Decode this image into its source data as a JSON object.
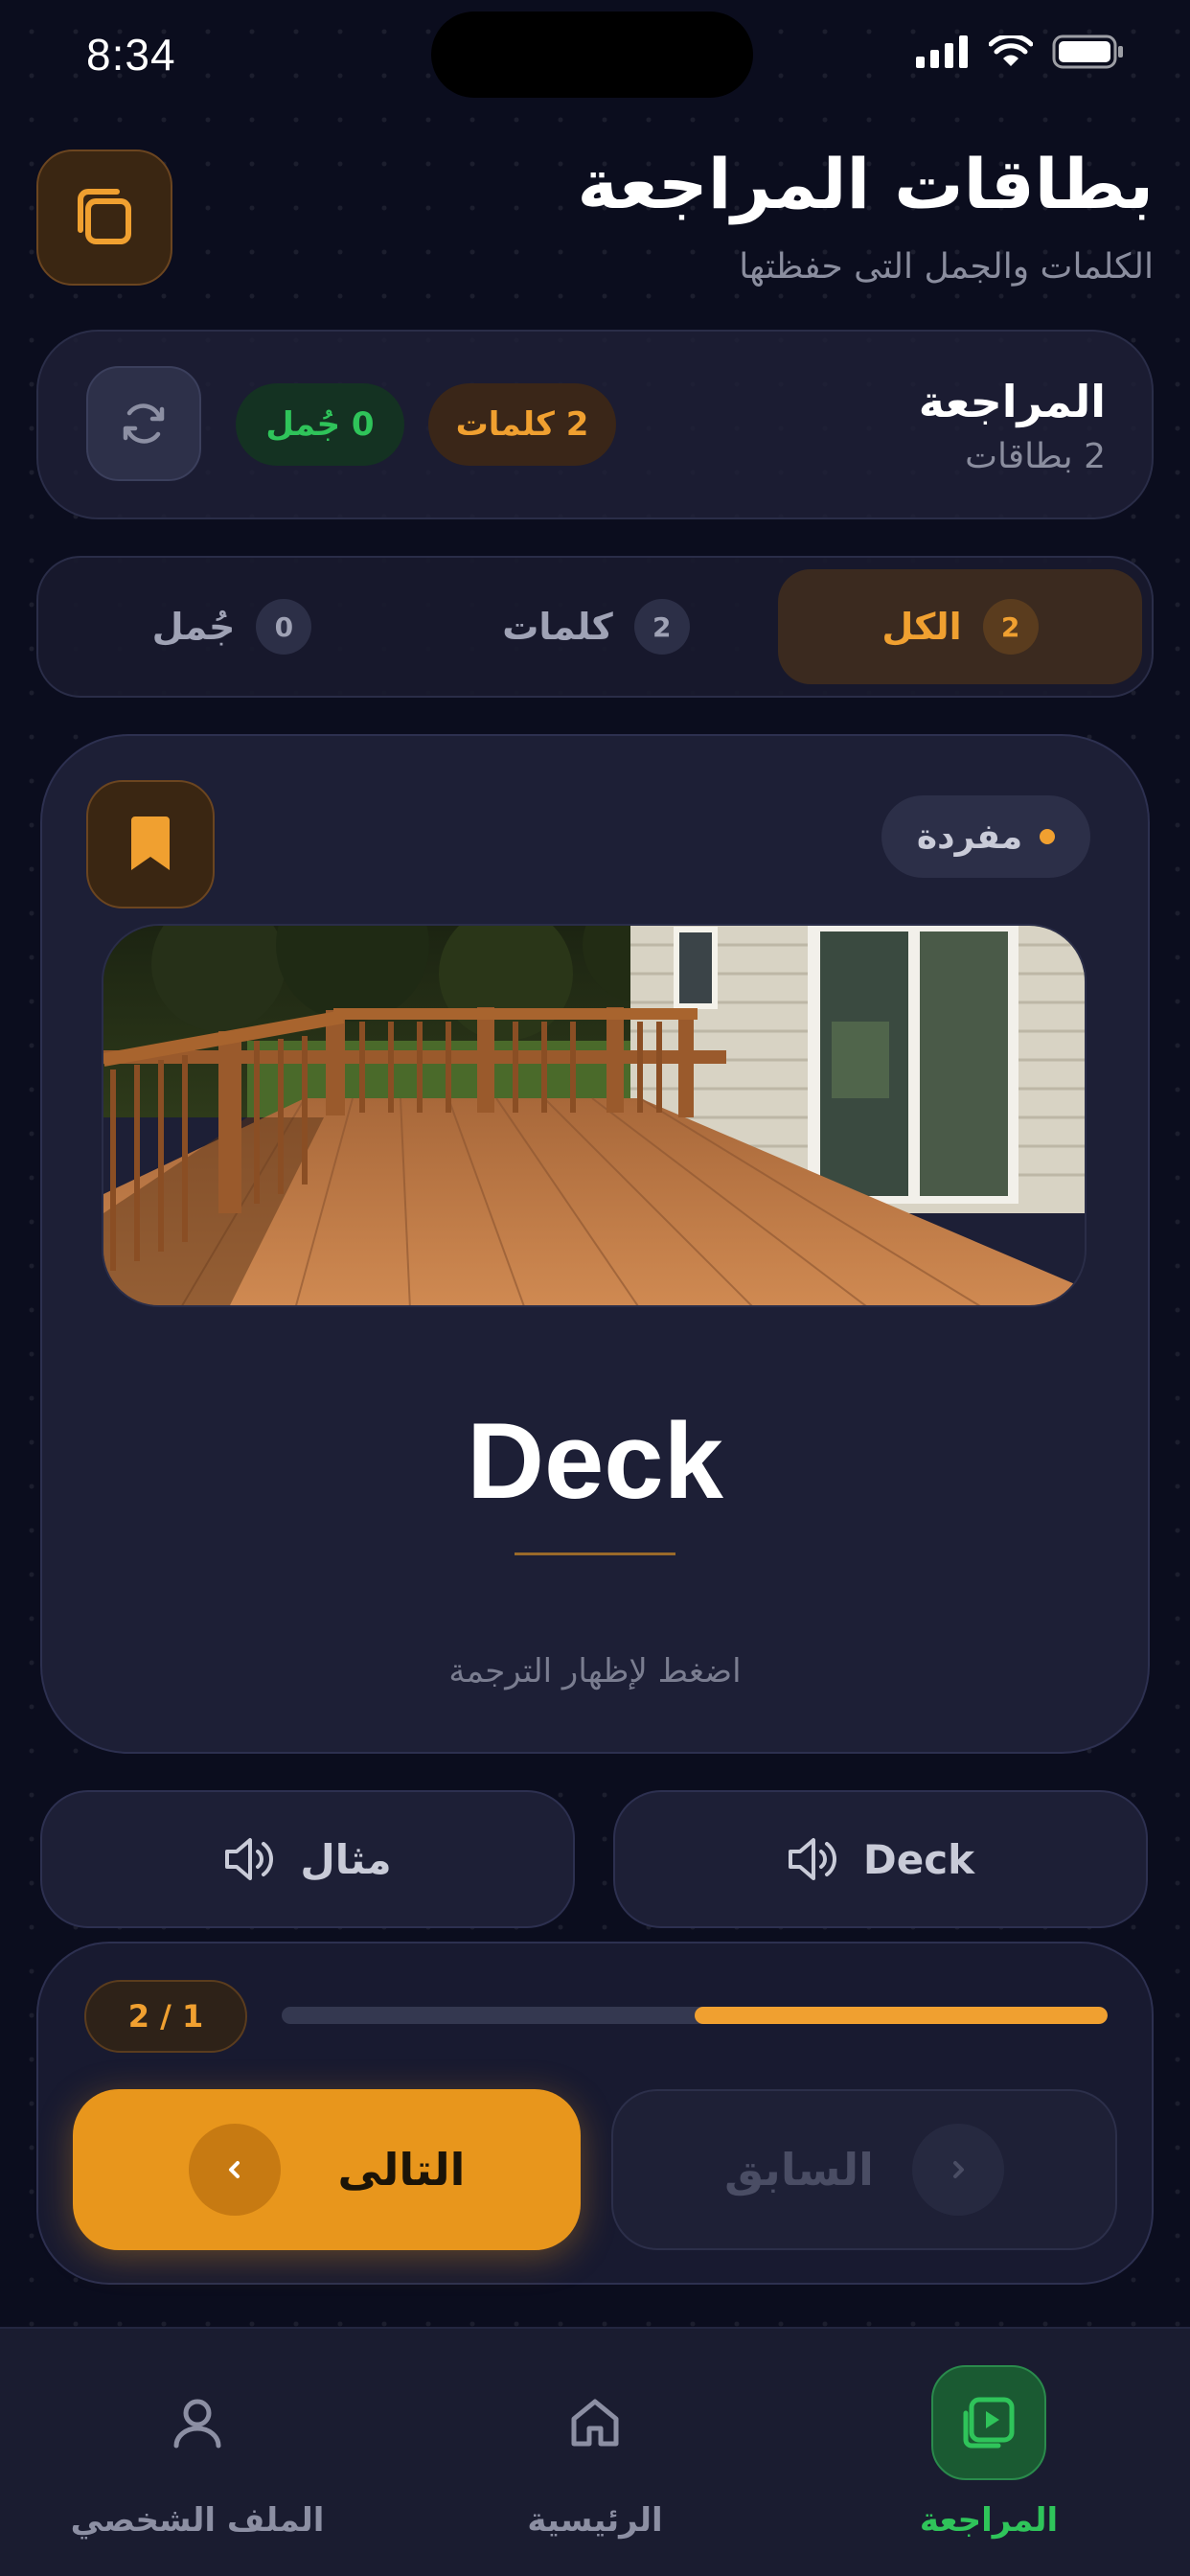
{
  "status_bar": {
    "time": "8:34"
  },
  "header": {
    "title": "بطاقات المراجعة",
    "subtitle": "الكلمات والجمل التى حفظتها"
  },
  "review": {
    "title": "المراجعة",
    "count_label": "2 بطاقات",
    "words_badge": "2 كلمات",
    "phrases_badge": "0 جُمل"
  },
  "tabs": [
    {
      "label": "الكل",
      "count": "2",
      "active": true
    },
    {
      "label": "كلمات",
      "count": "2",
      "active": false
    },
    {
      "label": "جُمل",
      "count": "0",
      "active": false
    }
  ],
  "card": {
    "type_label": "مفردة",
    "word": "Deck",
    "hint": "اضغط لإظهار الترجمة"
  },
  "sound_buttons": {
    "word_label": "Deck",
    "example_label": "مثال"
  },
  "progress": {
    "label": "2 / 1",
    "fraction": 0.5,
    "next_label": "التالى",
    "prev_label": "السابق"
  },
  "bottom_nav": {
    "review": "المراجعة",
    "home": "الرئيسية",
    "profile": "الملف الشخصي"
  },
  "colors": {
    "accent": "#f0a030",
    "success": "#2fc45a",
    "background": "#0b0d1e"
  }
}
